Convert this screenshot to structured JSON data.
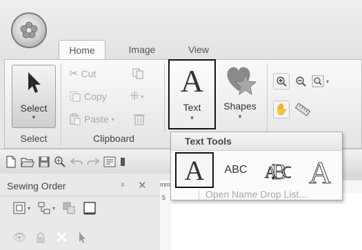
{
  "tabs": [
    "Home",
    "Image",
    "View"
  ],
  "home": {
    "select": {
      "label": "Select",
      "group": "Select"
    },
    "clipboard": {
      "cut": "Cut",
      "copy": "Copy",
      "paste": "Paste",
      "group": "Clipboard"
    },
    "text_button": {
      "icon": "A",
      "label": "Text"
    },
    "shapes_button": {
      "label": "Shapes"
    }
  },
  "text_tools": {
    "title": "Text Tools",
    "tiles": [
      "A",
      "ABC"
    ],
    "open_name_drop_list": "Open Name Drop List..."
  },
  "panel": {
    "title": "Sewing Order",
    "pin": "ᵖ",
    "close": "✕"
  },
  "ruler": {
    "unit": "mm",
    "tick": "5"
  },
  "colors": {
    "text_button_border": "#111111",
    "ribbon_bg": "#f3f3f3",
    "menu_bg": "#fbfbfb"
  }
}
